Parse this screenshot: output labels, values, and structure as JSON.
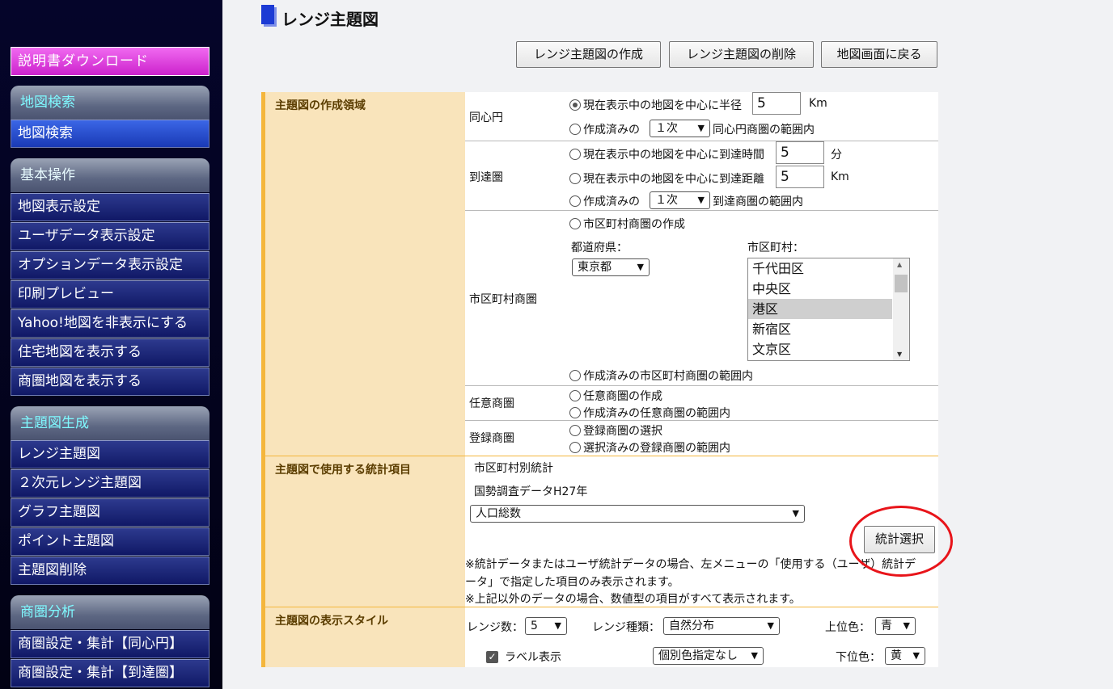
{
  "sidebar": {
    "download": "説明書ダウンロード",
    "groups": [
      {
        "header": "地図検索",
        "items": [
          "地図検索"
        ]
      },
      {
        "header": "基本操作",
        "items": [
          "地図表示設定",
          "ユーザデータ表示設定",
          "オプションデータ表示設定",
          "印刷プレビュー",
          "Yahoo!地図を非表示にする",
          "住宅地図を表示する",
          "商圏地図を表示する"
        ]
      },
      {
        "header": "主題図生成",
        "items": [
          "レンジ主題図",
          "２次元レンジ主題図",
          "グラフ主題図",
          "ポイント主題図",
          "主題図削除"
        ]
      },
      {
        "header": "商圏分析",
        "items": [
          "商圏設定・集計【同心円】",
          "商圏設定・集計【到達圏】"
        ]
      }
    ]
  },
  "main": {
    "title": "レンジ主題図",
    "buttons": {
      "create": "レンジ主題図の作成",
      "delete": "レンジ主題図の削除",
      "back": "地図画面に戻る"
    }
  },
  "area_section": {
    "label": "主題図の作成領域",
    "concentric": {
      "label": "同心円",
      "opt1": "現在表示中の地図を中心に半径",
      "radius_value": "5",
      "radius_unit": "Km",
      "opt2_pre": "作成済みの",
      "opt2_select": "１次",
      "opt2_post": "同心円商圏の範囲内"
    },
    "reach": {
      "label": "到達圏",
      "opt1": "現在表示中の地図を中心に到達時間",
      "time_value": "5",
      "time_unit": "分",
      "opt2": "現在表示中の地図を中心に到達距離",
      "dist_value": "5",
      "dist_unit": "Km",
      "opt3_pre": "作成済みの",
      "opt3_select": "１次",
      "opt3_post": "到達商圏の範囲内"
    },
    "municipal": {
      "label": "市区町村商圏",
      "opt1": "市区町村商圏の作成",
      "pref_label": "都道府県：",
      "pref_value": "東京都",
      "city_label": "市区町村：",
      "cities": [
        "千代田区",
        "中央区",
        "港区",
        "新宿区",
        "文京区"
      ],
      "selected_city": "港区",
      "opt2": "作成済みの市区町村商圏の範囲内"
    },
    "arbitrary": {
      "label": "任意商圏",
      "opt1": "任意商圏の作成",
      "opt2": "作成済みの任意商圏の範囲内"
    },
    "registered": {
      "label": "登録商圏",
      "opt1": "登録商圏の選択",
      "opt2": "選択済みの登録商圏の範囲内"
    }
  },
  "stats_section": {
    "label": "主題図で使用する統計項目",
    "line1": "市区町村別統計",
    "line2": "国勢調査データH27年",
    "item_select": "人口総数",
    "button": "統計選択",
    "note1a": "※統計データまたはユーザ統計データの場合、左メニューの「使用する（ユーザ）統計デ",
    "note1b": "ータ」で指定した項目のみ表示されます。",
    "note2": "※上記以外のデータの場合、数値型の項目がすべて表示されます。"
  },
  "style_section": {
    "label": "主題図の表示スタイル",
    "range_count_label": "レンジ数：",
    "range_count": "5",
    "range_type_label": "レンジ種類：",
    "range_type": "自然分布",
    "upper_color_label": "上位色：",
    "upper_color": "青",
    "label_display": "ラベル表示",
    "color_spec": "個別色指定なし",
    "lower_color_label": "下位色：",
    "lower_color": "黄"
  }
}
